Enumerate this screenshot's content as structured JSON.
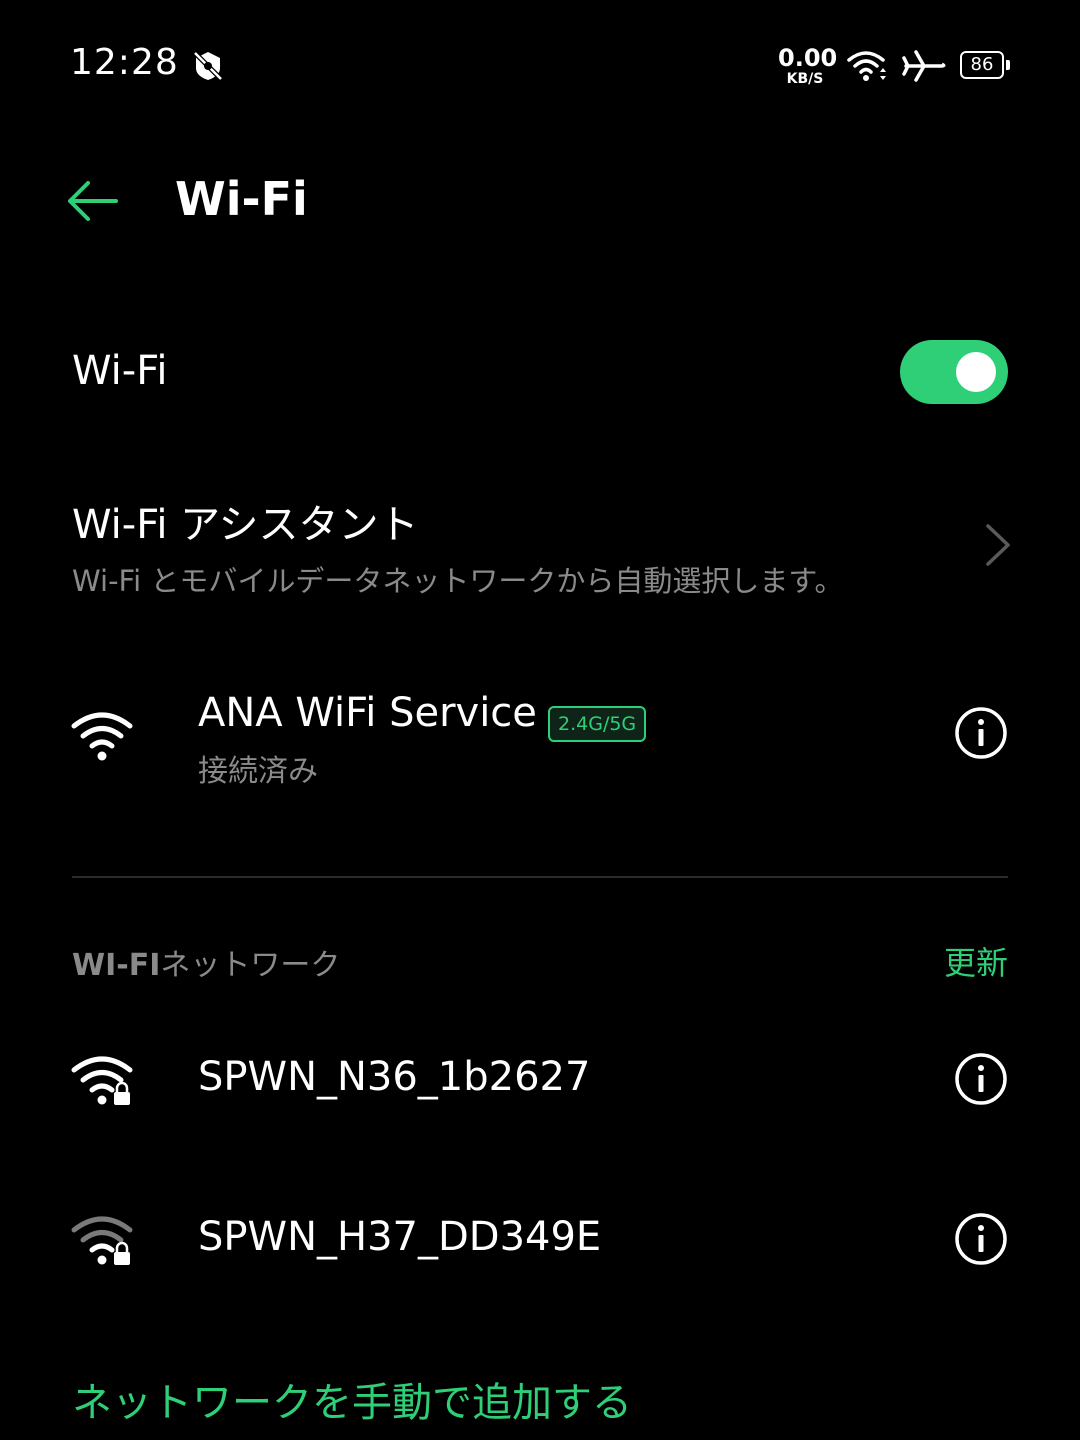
{
  "status_bar": {
    "time": "12:28",
    "net_speed_value": "0.00",
    "net_speed_unit": "KB/S",
    "battery": "86",
    "icons": [
      "notification-silenced-icon",
      "wifi-icon",
      "airplane-icon",
      "battery-icon"
    ]
  },
  "header": {
    "title": "Wi-Fi",
    "back_icon": "arrow-left-icon"
  },
  "wifi_toggle": {
    "label": "Wi-Fi",
    "enabled": true
  },
  "assistant": {
    "title": "Wi-Fi アシスタント",
    "subtitle": "Wi-Fi とモバイルデータネットワークから自動選択します。"
  },
  "connected_network": {
    "name": "ANA WiFi Service",
    "band": "2.4G/5G",
    "status": "接続済み"
  },
  "networks_section": {
    "title_bold": "WI-FI",
    "title_rest": "ネットワーク",
    "refresh_label": "更新"
  },
  "networks": [
    {
      "name": "SPWN_N36_1b2627",
      "secured": true,
      "signal": "strong"
    },
    {
      "name": "SPWN_H37_DD349E",
      "secured": true,
      "signal": "weak"
    }
  ],
  "add_network_label": "ネットワークを手動で追加する",
  "colors": {
    "accent": "#2fcf78",
    "background": "#000000",
    "secondary_text": "#8a8a8a",
    "divider": "#2b2b2b"
  }
}
